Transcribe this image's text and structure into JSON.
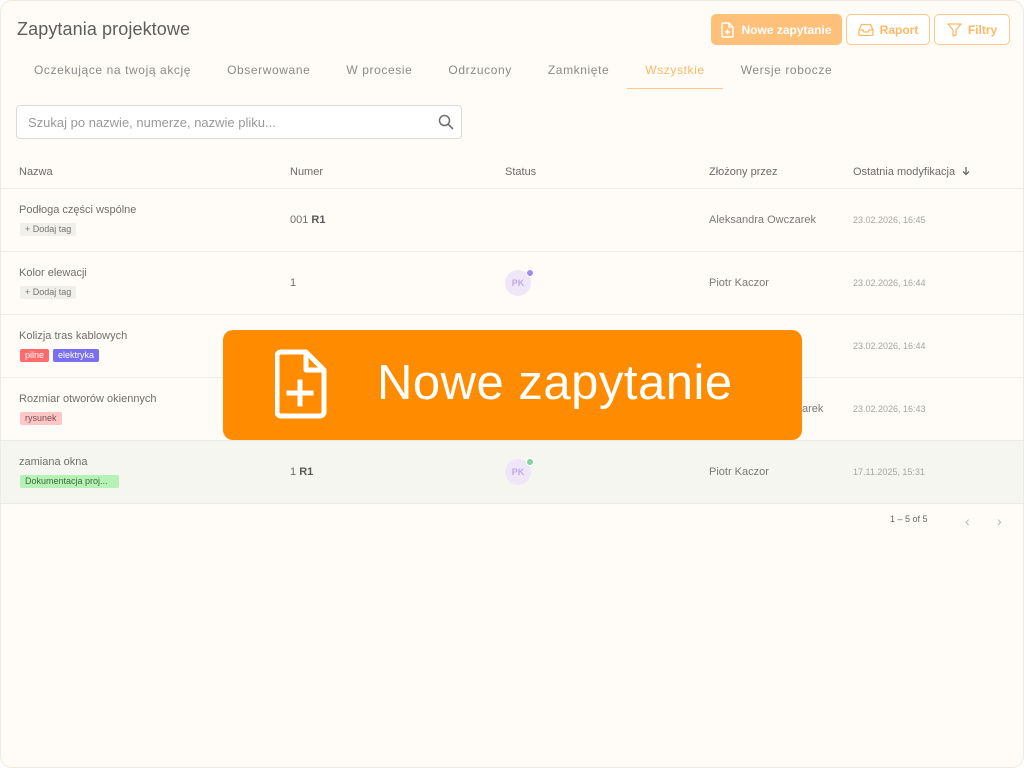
{
  "page": {
    "title": "Zapytania projektowe"
  },
  "toolbar": {
    "new_label": "Nowe zapytanie",
    "report_label": "Raport",
    "filters_label": "Filtry"
  },
  "tabs": [
    {
      "label": "Oczekujące na twoją akcję",
      "active": false
    },
    {
      "label": "Obserwowane",
      "active": false
    },
    {
      "label": "W procesie",
      "active": false
    },
    {
      "label": "Odrzucony",
      "active": false
    },
    {
      "label": "Zamknięte",
      "active": false
    },
    {
      "label": "Wszystkie",
      "active": true
    },
    {
      "label": "Wersje robocze",
      "active": false
    }
  ],
  "search": {
    "placeholder": "Szukaj po nazwie, numerze, nazwie pliku...",
    "value": ""
  },
  "table": {
    "columns": {
      "name": "Nazwa",
      "number": "Numer",
      "status": "Status",
      "author": "Złożony przez",
      "modified": "Ostatnia modyfikacja"
    },
    "rows": [
      {
        "name": "Podłoga części wspólne",
        "tags": [
          "+ Dodaj tag"
        ],
        "number": "001",
        "revision": "R1",
        "status_avatar": "",
        "author": "Aleksandra Owczarek",
        "modified": "23.02.2026, 16:45"
      },
      {
        "name": "Kolor elewacji",
        "tags": [
          "+ Dodaj tag"
        ],
        "number": "1",
        "revision": "",
        "status_avatar": "PK",
        "author": "Piotr Kaczor",
        "modified": "23.02.2026, 16:44"
      },
      {
        "name": "Kolizja tras kablowych",
        "tags": [
          "pilne",
          "elektryka"
        ],
        "number": "",
        "revision": "",
        "status_avatar": "",
        "author": "",
        "modified": "23.02.2026, 16:44"
      },
      {
        "name": "Rozmiar otworów okiennych",
        "tags": [
          "rysunek"
        ],
        "number": "",
        "revision": "",
        "status_avatar": "",
        "author": "arek",
        "modified": "23.02.2026, 16:43"
      },
      {
        "name": "zamiana okna",
        "tags": [
          "Dokumentacja proj..."
        ],
        "number": "1",
        "revision": "R1",
        "status_avatar": "PK",
        "author": "Piotr Kaczor",
        "modified": "17.11.2025, 15:31"
      }
    ]
  },
  "pagination": {
    "text": "1 – 5 of 5",
    "prev": "‹",
    "next": "›"
  },
  "overlay": {
    "label": "Nowe zapytanie"
  },
  "colors": {
    "accent": "#ff8c00",
    "accent_soft": "#ffc07a",
    "background": "#fffcf7",
    "tag_pilne": "#ff6b6b",
    "tag_elektryka": "#7a6ff0",
    "tag_rysunek": "#ffc6c6",
    "tag_dokumentacja": "#b6f1b6"
  },
  "icons": {
    "new": "file-plus-icon",
    "report": "inbox-icon",
    "filters": "filter-icon",
    "search": "search-icon",
    "sort": "arrow-down-icon"
  }
}
